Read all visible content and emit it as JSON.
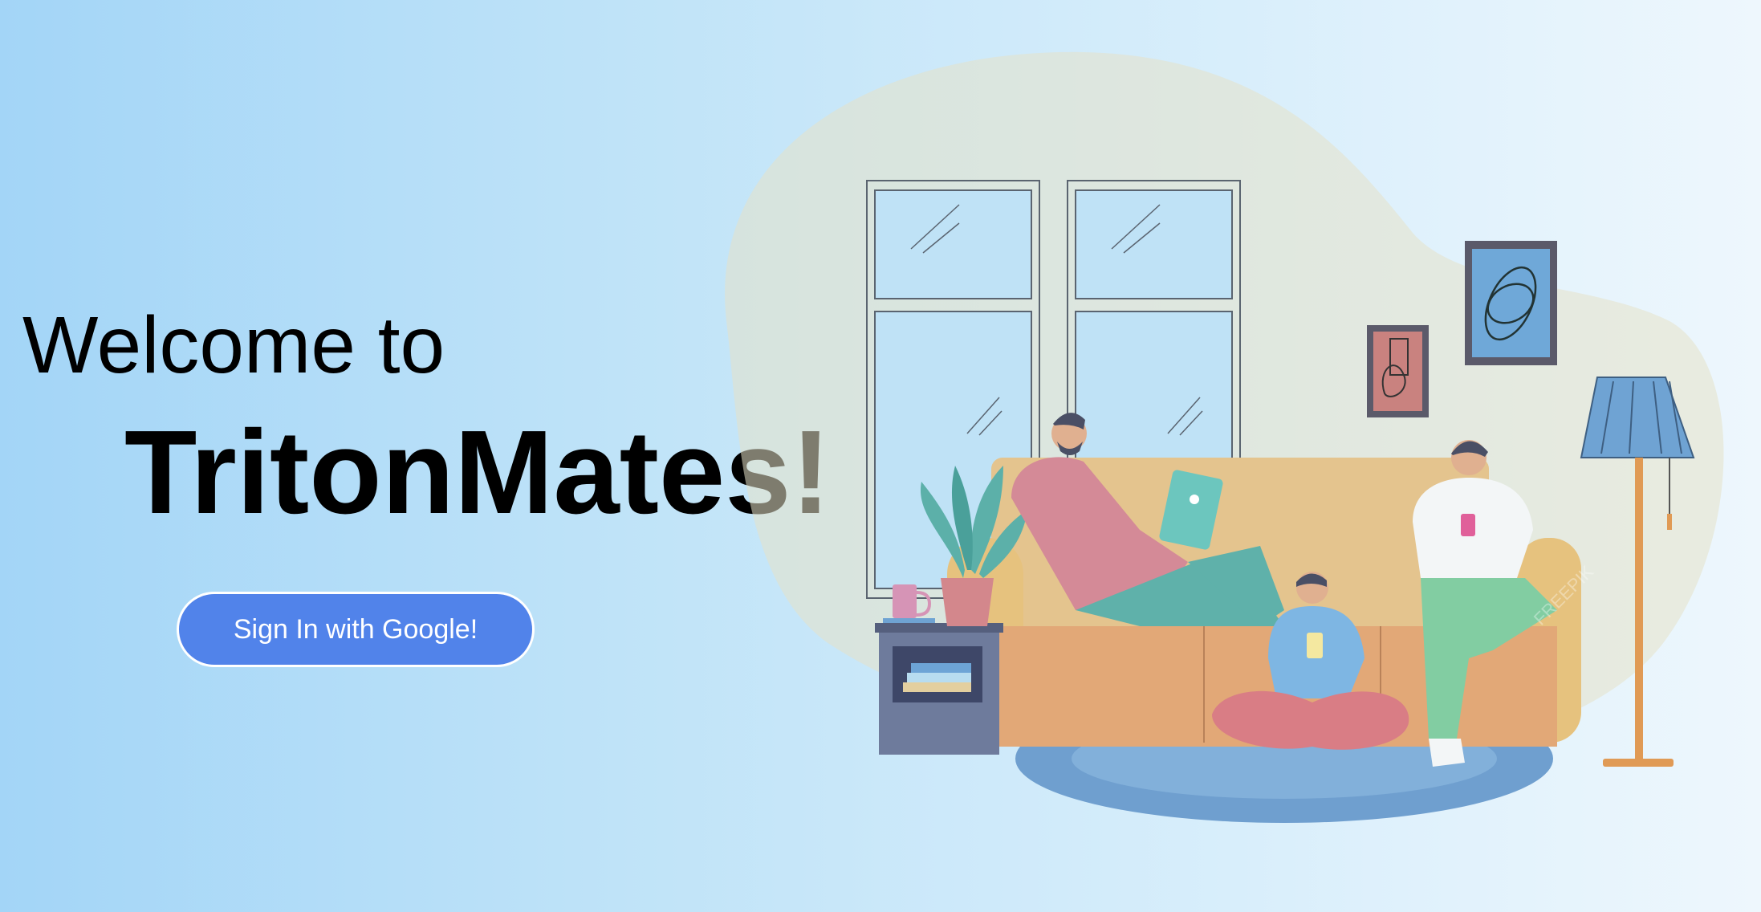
{
  "hero": {
    "welcome_text": "Welcome to",
    "brand_name": "TritonMates!",
    "signin_label": "Sign In with Google!"
  },
  "illustration": {
    "watermark": "FREEPIK"
  },
  "colors": {
    "background_left": "#a3d5f7",
    "background_right": "#eef7fd",
    "button_fill": "#5183ea",
    "button_border": "#ffffff",
    "button_text": "#ffffff",
    "title_text": "#000000"
  }
}
